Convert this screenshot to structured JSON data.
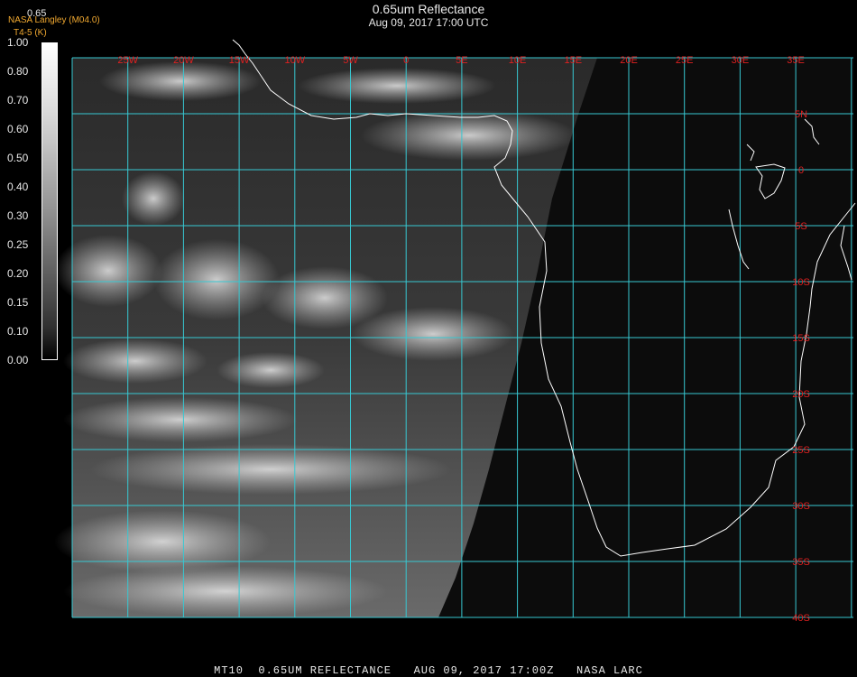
{
  "header": {
    "title": "0.65um Reflectance",
    "datetime": "Aug 09, 2017 17:00 UTC"
  },
  "credit": {
    "agency": "NASA Langley (M04.0)",
    "product": "T4-5 (K)"
  },
  "colorbar": {
    "top_value": "0.65",
    "labels": [
      "1.00",
      "0.80",
      "0.70",
      "0.60",
      "0.50",
      "0.40",
      "0.30",
      "0.25",
      "0.20",
      "0.15",
      "0.10",
      "0.00"
    ]
  },
  "map": {
    "lon_labels": [
      "25W",
      "20W",
      "15W",
      "10W",
      "5W",
      "0",
      "5E",
      "10E",
      "15E",
      "20E",
      "25E",
      "30E",
      "35E"
    ],
    "lat_labels": [
      "5N",
      "0",
      "5S",
      "10S",
      "15S",
      "20S",
      "25S",
      "30S",
      "35S",
      "40S"
    ],
    "grid_color": "#37c8d2",
    "label_color": "#e02020",
    "coast_color": "#ffffff"
  },
  "footer": {
    "text": "MT10  0.65UM REFLECTANCE   AUG 09, 2017 17:00Z   NASA LARC"
  }
}
